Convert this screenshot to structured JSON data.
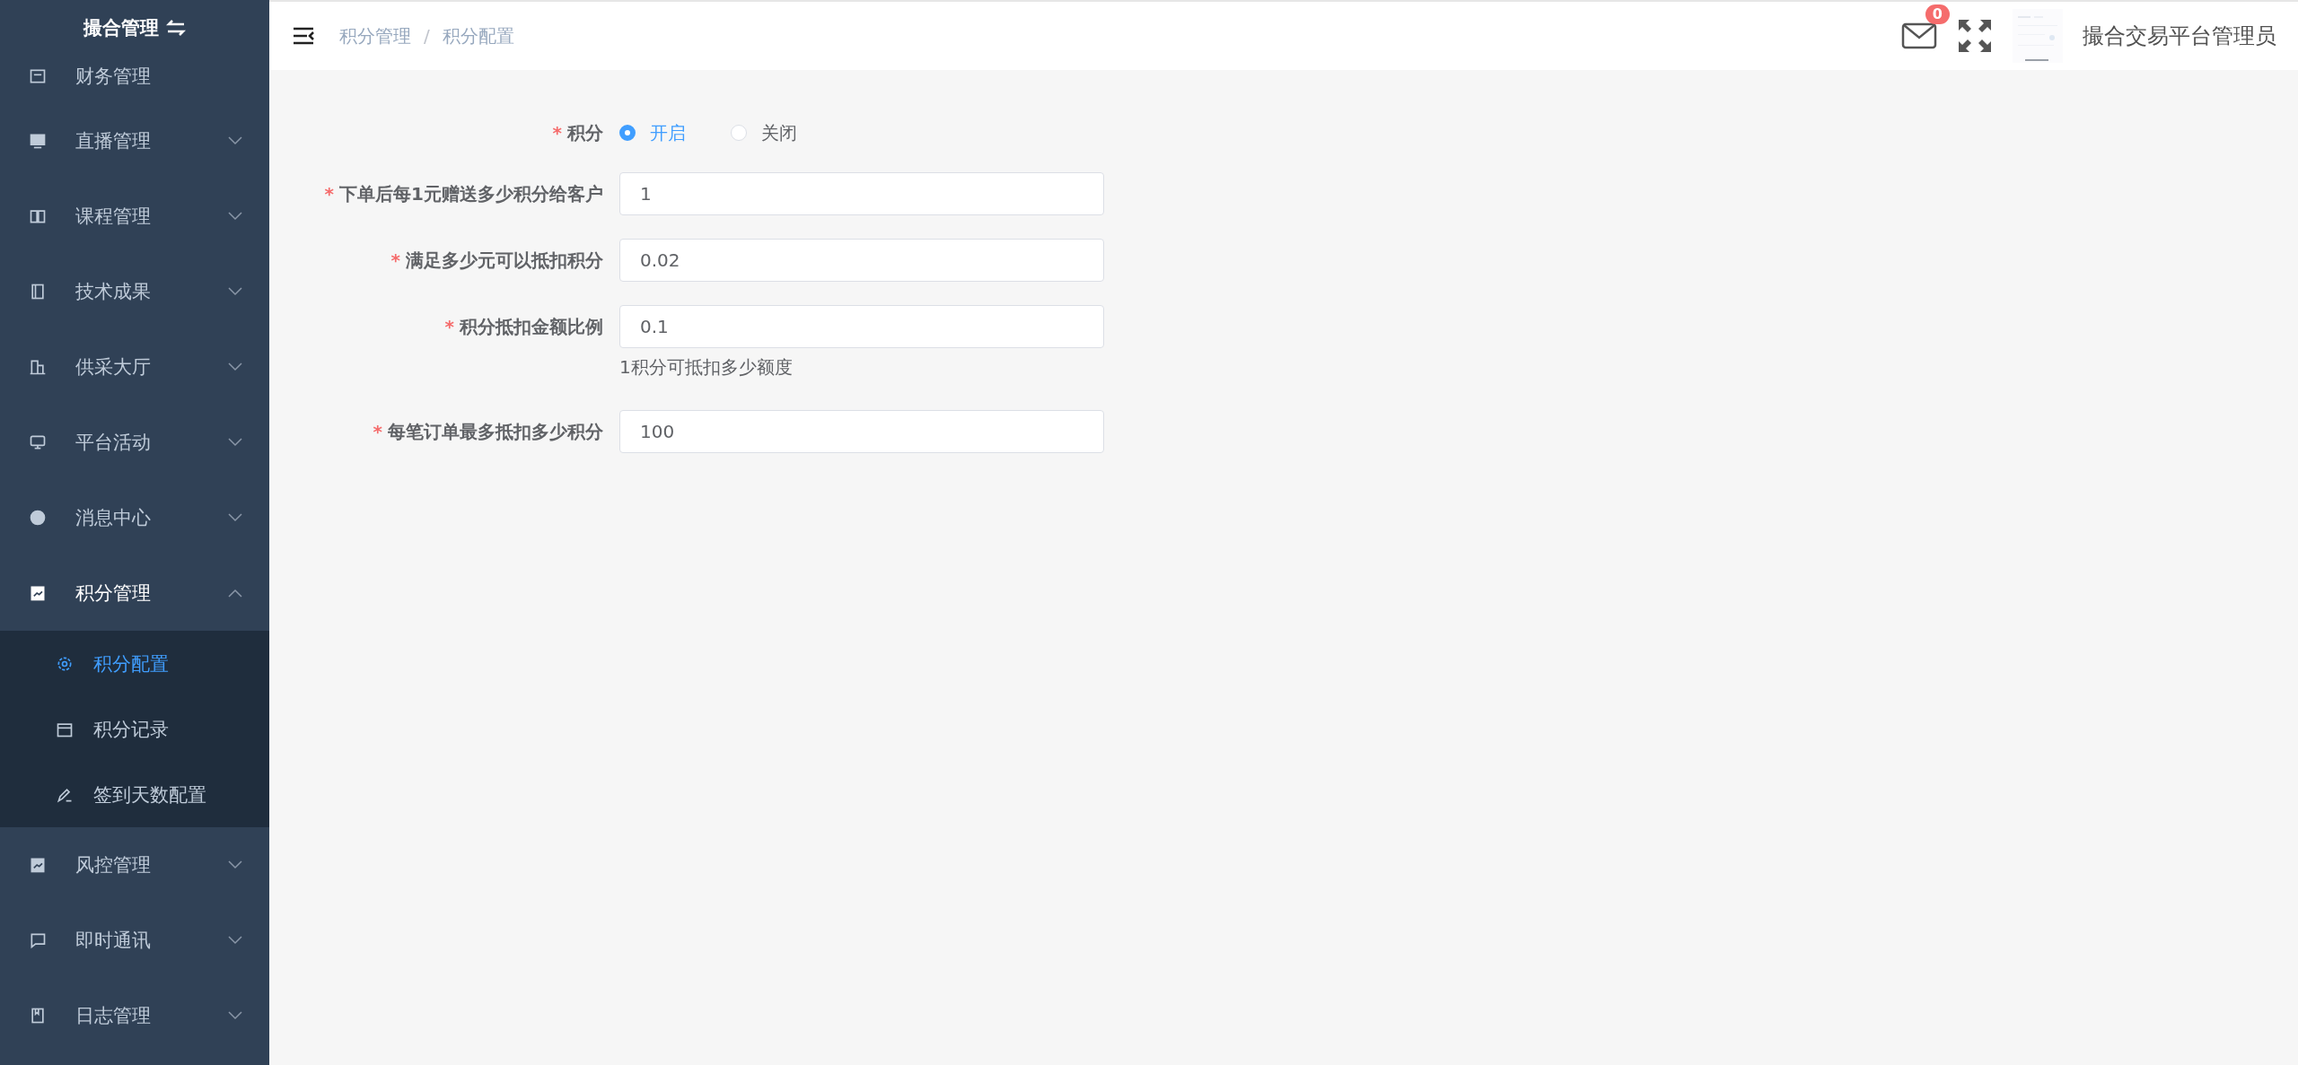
{
  "sidebar": {
    "title": "撮合管理",
    "items": [
      {
        "label": "财务管理",
        "expanded": false
      },
      {
        "label": "直播管理",
        "expanded": false
      },
      {
        "label": "课程管理",
        "expanded": false
      },
      {
        "label": "技术成果",
        "expanded": false
      },
      {
        "label": "供采大厅",
        "expanded": false
      },
      {
        "label": "平台活动",
        "expanded": false
      },
      {
        "label": "消息中心",
        "expanded": false
      },
      {
        "label": "积分管理",
        "expanded": true,
        "children": [
          {
            "label": "积分配置",
            "selected": true
          },
          {
            "label": "积分记录",
            "selected": false
          },
          {
            "label": "签到天数配置",
            "selected": false
          }
        ]
      },
      {
        "label": "风控管理",
        "expanded": false
      },
      {
        "label": "即时通讯",
        "expanded": false
      },
      {
        "label": "日志管理",
        "expanded": false
      }
    ]
  },
  "header": {
    "breadcrumb": [
      "积分管理",
      "积分配置"
    ],
    "separator": "/",
    "mail_badge": "0",
    "user": "撮合交易平台管理员"
  },
  "form": {
    "switch": {
      "label": "积分",
      "marker": "*",
      "options": [
        {
          "label": "开启",
          "selected": true
        },
        {
          "label": "关闭",
          "selected": false
        }
      ]
    },
    "fields": [
      {
        "label": "下单后每1元赠送多少积分给客户",
        "marker": "*",
        "value": "1"
      },
      {
        "label": "满足多少元可以抵扣积分",
        "marker": "*",
        "value": "0.02"
      },
      {
        "label": "积分抵扣金额比例",
        "marker": "*",
        "value": "0.1",
        "help": "1积分可抵扣多少额度"
      },
      {
        "label": "每笔订单最多抵扣多少积分",
        "marker": "*",
        "value": "100"
      }
    ]
  }
}
